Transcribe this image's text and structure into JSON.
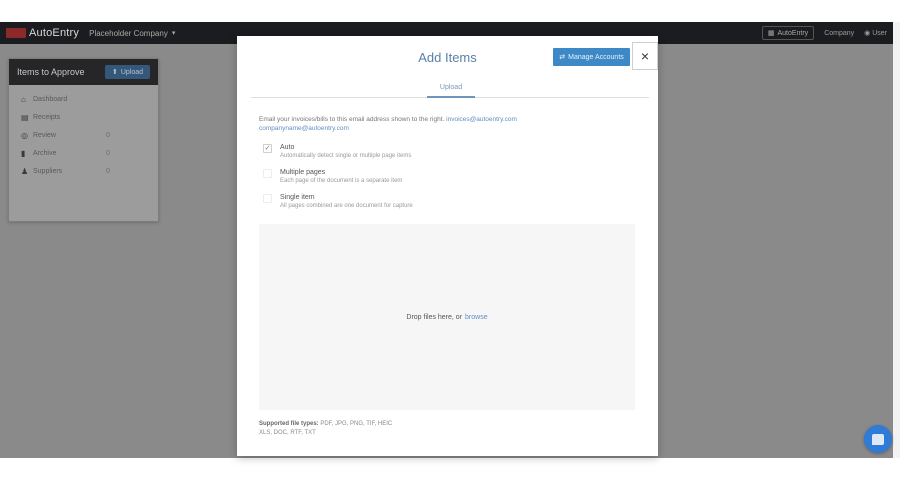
{
  "nav": {
    "brand": "AutoEntry",
    "org": "Placeholder Company",
    "right_pill": "AutoEntry",
    "right_link": "Company",
    "right_user": "User"
  },
  "sidebar": {
    "title": "Items to Approve",
    "upload_label": "Upload",
    "items": [
      {
        "icon": "home",
        "label": "Dashboard",
        "count": ""
      },
      {
        "icon": "receipt",
        "label": "Receipts",
        "count": ""
      },
      {
        "icon": "eye",
        "label": "Review",
        "count": "0"
      },
      {
        "icon": "file",
        "label": "Archive",
        "count": "0"
      },
      {
        "icon": "user",
        "label": "Suppliers",
        "count": "0"
      }
    ]
  },
  "modal": {
    "title": "Add Items",
    "manage_label": "Manage Accounts",
    "close_glyph": "×",
    "tab": "Upload",
    "intro_text": "Email your invoices/bills to this email address shown to the right.",
    "intro_link": "invoices@autoentry.com",
    "intro_link2": "companyname@autoentry.com",
    "options": [
      {
        "label": "Auto",
        "desc": "Automatically detect single or multiple page items",
        "checked": true
      },
      {
        "label": "Multiple pages",
        "desc": "Each page of the document is a separate item",
        "checked": false
      },
      {
        "label": "Single item",
        "desc": "All pages combined are one document for capture",
        "checked": false
      }
    ],
    "dropzone_text": "Drop files here, or",
    "dropzone_link": "browse",
    "supported_label": "Supported file types:",
    "supported_types": "PDF, JPG, PNG, TIF, HEIC",
    "supported_line2": "XLS, DOC, RTF, TXT"
  },
  "chat_icon": "chat-icon"
}
